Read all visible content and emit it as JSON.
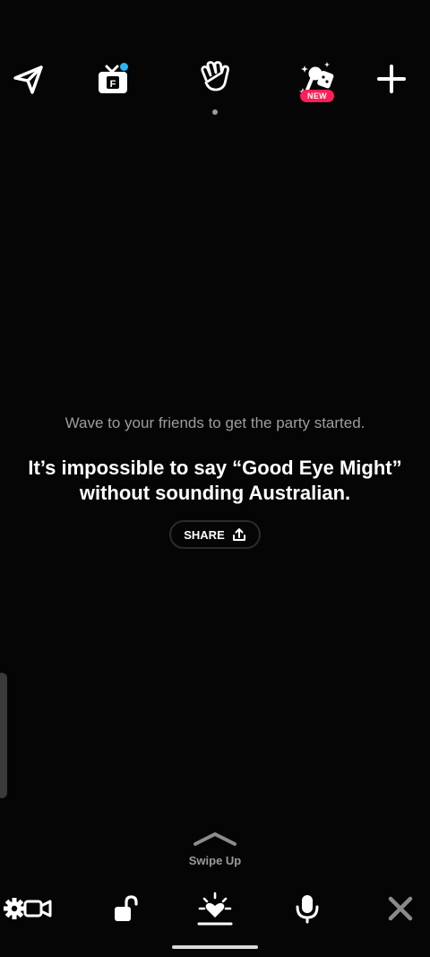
{
  "top_bar": {
    "send_icon": "paper-plane-icon",
    "tv_icon": "tv-icon",
    "tv_letter": "F",
    "wave_icon": "hand-wave-icon",
    "games_icon": "games-icon",
    "new_badge": "NEW",
    "add_icon": "plus-icon"
  },
  "main": {
    "subtitle": "Wave to your friends to get the party started.",
    "joke": "It’s impossible to say “Good Eye Might” without sounding Australian.",
    "share_label": "SHARE",
    "share_icon": "share-upload-icon"
  },
  "swipe": {
    "icon": "chevron-up-icon",
    "label": "Swipe Up"
  },
  "bottom_bar": {
    "settings_icon": "gear-camera-icon",
    "lock_icon": "unlock-icon",
    "wave_icon": "heart-lamp-icon",
    "mic_icon": "microphone-icon",
    "close_icon": "close-icon"
  },
  "colors": {
    "background": "#050505",
    "notification_dot": "#27b7f5",
    "new_badge": "#ff1e56",
    "muted_text": "#9d9d9d"
  }
}
